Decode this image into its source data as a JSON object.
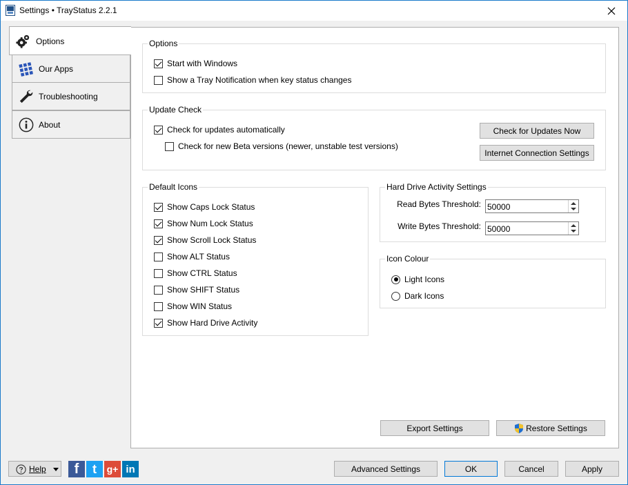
{
  "window": {
    "title": "Settings • TrayStatus 2.2.1"
  },
  "sidebar": {
    "items": [
      {
        "label": "Options",
        "icon": "gear-icon"
      },
      {
        "label": "Our Apps",
        "icon": "apps-grid-icon"
      },
      {
        "label": "Troubleshooting",
        "icon": "wrench-icon"
      },
      {
        "label": "About",
        "icon": "info-icon"
      }
    ],
    "active_index": 0
  },
  "options_group": {
    "title": "Options",
    "start_with_windows": {
      "label": "Start with Windows",
      "checked": true
    },
    "tray_notification": {
      "label": "Show a Tray Notification when key status changes",
      "checked": false
    }
  },
  "update_group": {
    "title": "Update Check",
    "check_auto": {
      "label": "Check for updates automatically",
      "checked": true
    },
    "check_beta": {
      "label": "Check for new Beta versions (newer, unstable test versions)",
      "checked": false
    },
    "check_now_label": "Check for Updates Now",
    "connection_label": "Internet Connection Settings"
  },
  "icons_group": {
    "title": "Default Icons",
    "items": [
      {
        "label": "Show Caps Lock Status",
        "checked": true
      },
      {
        "label": "Show Num Lock Status",
        "checked": true
      },
      {
        "label": "Show Scroll Lock Status",
        "checked": true
      },
      {
        "label": "Show ALT Status",
        "checked": false
      },
      {
        "label": "Show CTRL Status",
        "checked": false
      },
      {
        "label": "Show SHIFT Status",
        "checked": false
      },
      {
        "label": "Show WIN Status",
        "checked": false
      },
      {
        "label": "Show Hard Drive Activity",
        "checked": true
      }
    ]
  },
  "hdd_group": {
    "title": "Hard Drive Activity Settings",
    "read_label": "Read Bytes Threshold:",
    "read_value": "50000",
    "write_label": "Write Bytes Threshold:",
    "write_value": "50000"
  },
  "colour_group": {
    "title": "Icon Colour",
    "light_label": "Light Icons",
    "dark_label": "Dark Icons",
    "selected": "light"
  },
  "panel_buttons": {
    "export_label": "Export Settings",
    "restore_label": "Restore Settings"
  },
  "footer": {
    "help_label": "Help",
    "social": [
      {
        "name": "facebook",
        "glyph": "f",
        "color": "#3b5998"
      },
      {
        "name": "twitter",
        "glyph": "t",
        "color": "#1da1f2"
      },
      {
        "name": "google-plus",
        "glyph": "g+",
        "color": "#dd4b39"
      },
      {
        "name": "linkedin",
        "glyph": "in",
        "color": "#0077b5"
      }
    ],
    "advanced_label": "Advanced Settings",
    "ok_label": "OK",
    "cancel_label": "Cancel",
    "apply_label": "Apply"
  }
}
